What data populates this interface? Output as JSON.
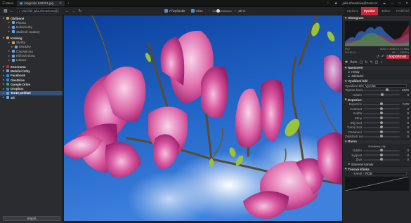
{
  "titlebar": {
    "menu_label": "Menu",
    "tab_label": "magnolie 529301.jpg",
    "plus": "+",
    "email": "julia.rihnaxlova@zone.cz",
    "win_controls": [
      "—",
      "□",
      "✕"
    ]
  },
  "toolbar": {
    "path": "> Úložiště julia.rihnaxlova@zonerdrive.cz > Obrázky",
    "nav_icons": [
      "←",
      "→",
      "↻"
    ],
    "check1": "Přizpůsobit",
    "check2": "Histo",
    "zoom_value": "35 %"
  },
  "right_tabs": [
    {
      "label": "Správce",
      "active": false
    },
    {
      "label": "Vyvolat",
      "active": true
    },
    {
      "label": "Editor",
      "active": false
    },
    {
      "label": "Prohlížeč",
      "active": false
    }
  ],
  "sidebar": {
    "items": [
      {
        "label": "Oblíbené",
        "cls": "hdr",
        "ic": "f"
      },
      {
        "label": "Plocha",
        "cls": "indent1",
        "ic": ""
      },
      {
        "label": "Dokumenty",
        "cls": "indent1",
        "ic": ""
      },
      {
        "label": "Stažené soubory",
        "cls": "indent1",
        "ic": ""
      },
      {
        "label": "Katalog",
        "cls": "hdr gap",
        "ic": "f"
      },
      {
        "label": "Složky",
        "cls": "indent1",
        "ic": "f"
      },
      {
        "label": "Obrázky",
        "cls": "indent2",
        "ic": ""
      },
      {
        "label": "Časová osa",
        "cls": "indent1",
        "ic": ""
      },
      {
        "label": "Klíčová slova",
        "cls": "indent1",
        "ic": ""
      },
      {
        "label": "Lokace",
        "cls": "indent1",
        "ic": ""
      },
      {
        "label": "Zonerama",
        "cls": "hdr gap",
        "ic": "r"
      },
      {
        "label": "Mobilní fotky",
        "cls": "hdr",
        "ic": ""
      },
      {
        "label": "Facebook",
        "cls": "hdr",
        "ic": "b"
      },
      {
        "label": "OneDrive",
        "cls": "hdr",
        "ic": "b"
      },
      {
        "label": "Google Drive",
        "cls": "hdr",
        "ic": "g"
      },
      {
        "label": "Dropbox",
        "cls": "hdr",
        "ic": "b"
      },
      {
        "label": "Tento počítač",
        "cls": "hdr sel",
        "ic": ""
      },
      {
        "label": "Síť",
        "cls": "hdr",
        "ic": ""
      }
    ],
    "import_label": "Import"
  },
  "right_panel": {
    "histogram_title": "Histogram",
    "hist_info_left": "R:218 G:.. ..",
    "hist_info_right": "6000 × 4000 (2,73 MB)",
    "hist_info_left2": "ISO",
    "hist_info_right2": "f/8 — 1/500 s",
    "export_label": "Exportovat",
    "auto_label": "Auto",
    "nastaveni": "Nastavení",
    "hledy": "Hledy",
    "zakladni": "Základní",
    "vyvazeni": "Vyvážení bílé",
    "wb_label": "Vyvážení bílé",
    "wb_value": "Vyvolat",
    "teplota_label": "Teplota barev",
    "teplota_value": "5600",
    "odstin_label": "Odstín",
    "odstin_value": "0",
    "expozice_title": "Expozice",
    "sliders": [
      {
        "label": "Expozice",
        "value": "0,00",
        "pos": 0.5
      },
      {
        "label": "Kontrast",
        "value": "0",
        "pos": 0.5
      },
      {
        "label": "Světla",
        "value": "0",
        "pos": 0.5
      },
      {
        "label": "Stíny",
        "value": "0",
        "pos": 0.5
      },
      {
        "label": "Bílý bod",
        "value": "0",
        "pos": 0.5
      },
      {
        "label": "Černý bod",
        "value": "0",
        "pos": 0.5
      },
      {
        "label": "Ozdobení",
        "value": "0",
        "pos": 0.5
      },
      {
        "label": "Zvládnutí svazu",
        "value": "0",
        "pos": 0.5
      }
    ],
    "barva_title": "Barva",
    "barva_sub": "Dobládný bílý",
    "barva_sliders": [
      {
        "label": "Odstín",
        "value": "0",
        "pos": 0.5
      },
      {
        "label": "Sytýost",
        "value": "0",
        "pos": 0.5
      },
      {
        "label": "Živá",
        "value": "0",
        "pos": 0.5
      }
    ],
    "barevne": "Barevné kanuly",
    "tonal_title": "Tónová křivka",
    "kanal_label": "Kanál",
    "kanal_value": "RGB"
  }
}
